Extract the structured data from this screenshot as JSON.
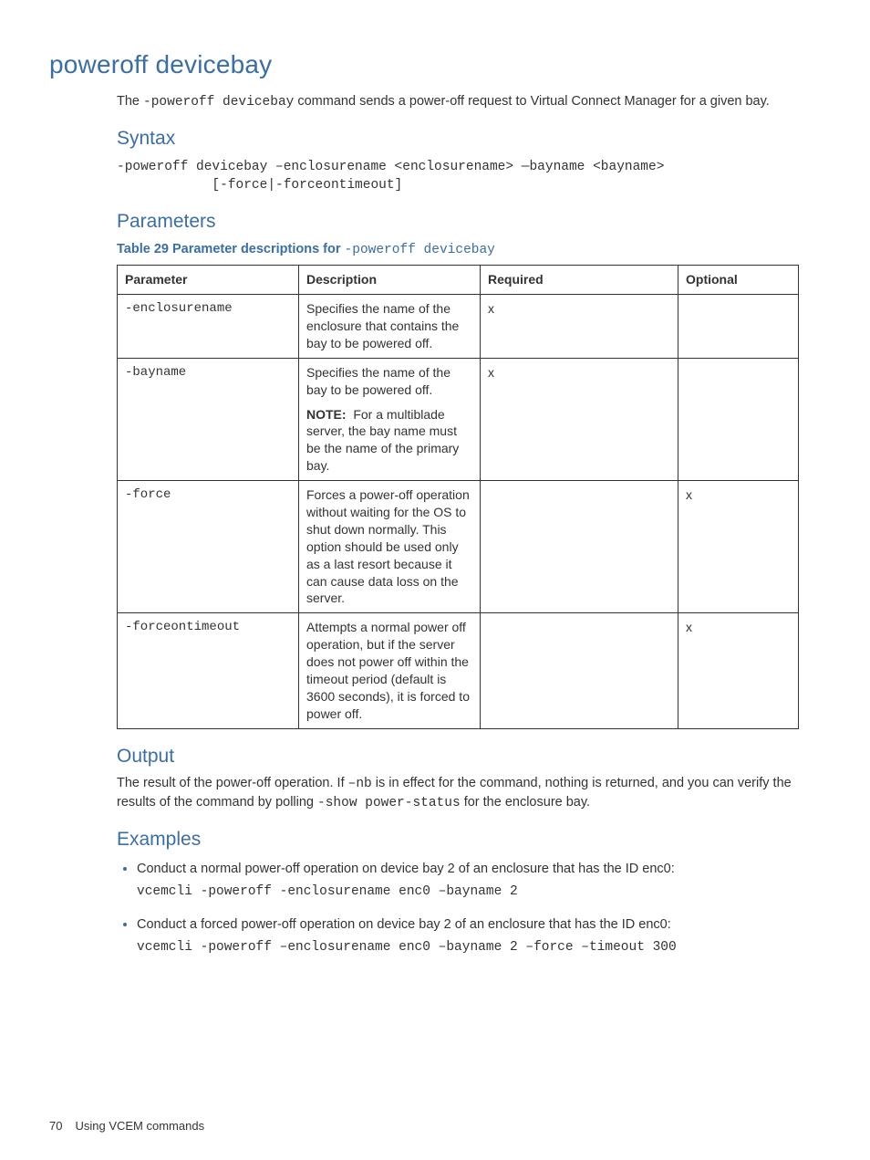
{
  "title": "poweroff devicebay",
  "intro_pre": "The ",
  "intro_code": "-poweroff devicebay",
  "intro_post": " command sends a power-off request to Virtual Connect Manager for a given bay.",
  "syntax_heading": "Syntax",
  "syntax_line1": "-poweroff devicebay –enclosurename <enclosurename> —bayname <bayname>",
  "syntax_line2": "            [-force|-forceontimeout]",
  "params_heading": "Parameters",
  "table_caption_prefix": "Table 29 Parameter descriptions for ",
  "table_caption_code": "-poweroff devicebay",
  "th": {
    "param": "Parameter",
    "desc": "Description",
    "req": "Required",
    "opt": "Optional"
  },
  "rows": [
    {
      "param": "-enclosurename",
      "desc": "Specifies the name of the enclosure that contains the bay to be powered off.",
      "note": "",
      "req": "x",
      "opt": ""
    },
    {
      "param": "-bayname",
      "desc": "Specifies the name of the bay to be powered off.",
      "note": "For a multiblade server, the bay name must be the name of the primary bay.",
      "req": "x",
      "opt": ""
    },
    {
      "param": "-force",
      "desc": "Forces a power-off operation without waiting for the OS to shut down normally. This option should be used only as a last resort because it can cause data loss on the server.",
      "note": "",
      "req": "",
      "opt": "x"
    },
    {
      "param": "-forceontimeout",
      "desc": "Attempts a normal power off operation, but if the server does not power off within the timeout period (default is 3600 seconds), it is forced to power off.",
      "note": "",
      "req": "",
      "opt": "x"
    }
  ],
  "note_label": "NOTE:",
  "output_heading": "Output",
  "output_pre": "The result of the power-off operation. If ",
  "output_code1": "–nb",
  "output_mid": " is in effect for the command, nothing is returned, and you can verify the results of the command by polling ",
  "output_code2": "-show power-status",
  "output_post": " for the enclosure bay.",
  "examples_heading": "Examples",
  "examples": [
    {
      "text": "Conduct a normal power-off operation on device bay 2 of an enclosure that has the ID enc0:",
      "code": "vcemcli -poweroff -enclosurename enc0 –bayname 2"
    },
    {
      "text": "Conduct a forced power-off operation on device bay 2 of an enclosure that has the ID enc0:",
      "code": "vcemcli -poweroff –enclosurename enc0 –bayname 2 –force –timeout 300"
    }
  ],
  "footer_page": "70",
  "footer_text": "Using VCEM commands"
}
